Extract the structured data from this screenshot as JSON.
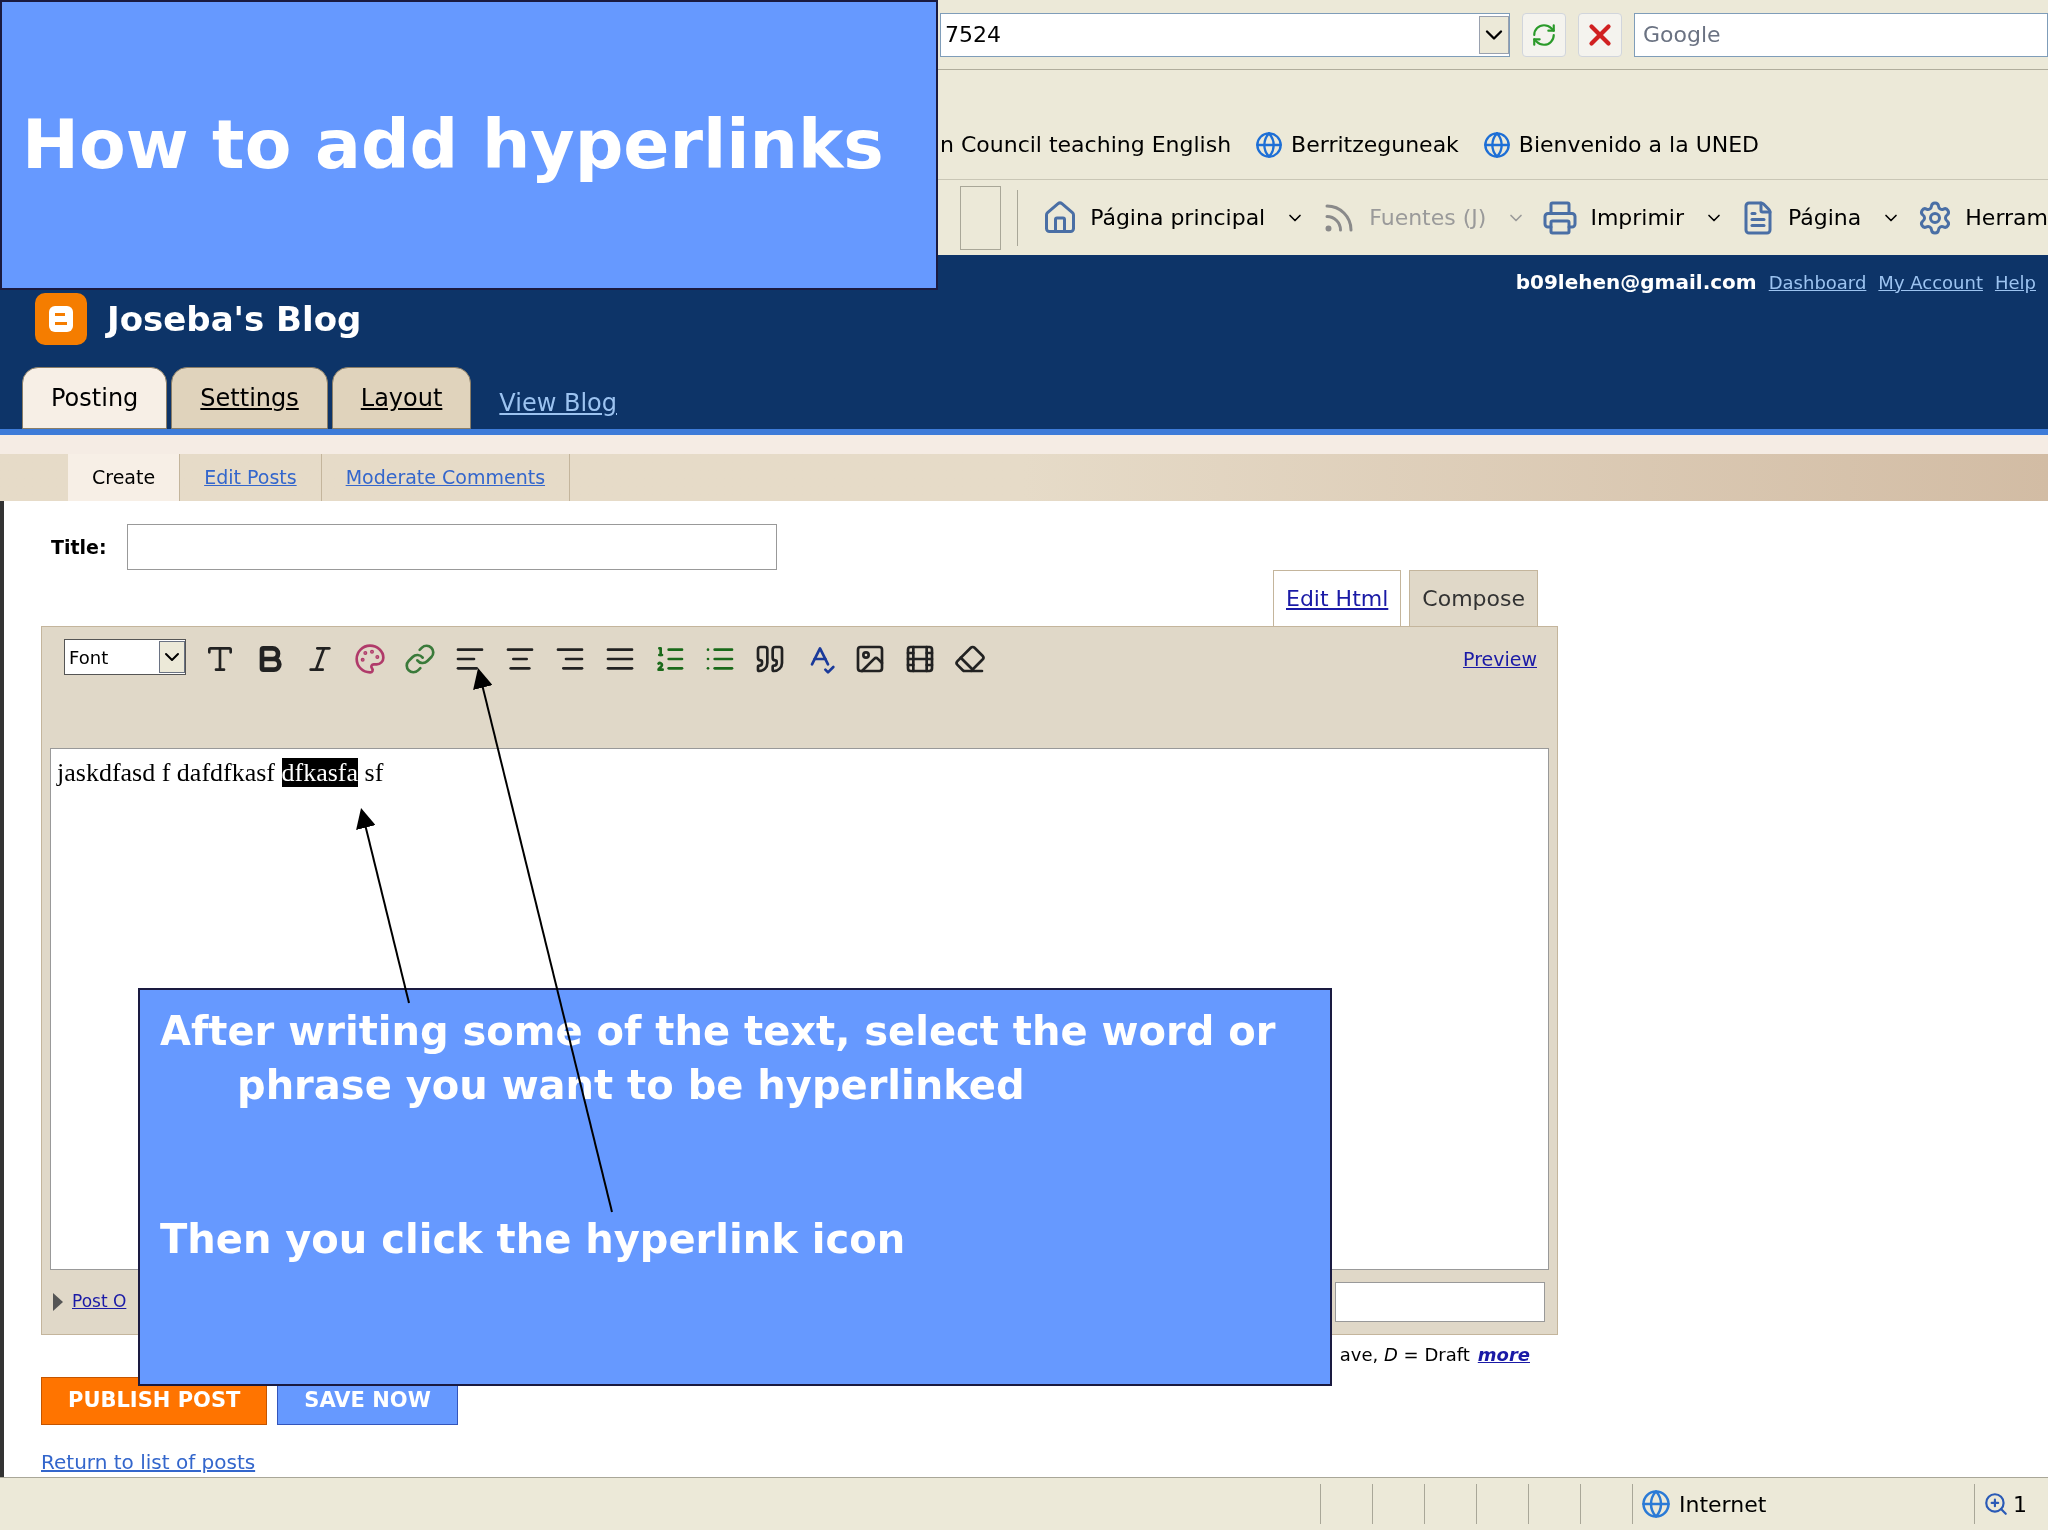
{
  "slide": {
    "title": "How to add hyperlinks",
    "callout": [
      "After writing some of the text, select the word or phrase you want to be hyperlinked",
      "Then you click the hyperlink icon"
    ]
  },
  "browser": {
    "address": "7524",
    "search_placeholder": "Google",
    "links": [
      "n Council teaching English",
      "Berritzeguneak",
      "Bienvenido a la UNED"
    ],
    "commands": [
      {
        "label": "Página principal",
        "kind": "home",
        "disabled": false
      },
      {
        "label": "Fuentes (J)",
        "kind": "feed",
        "disabled": true
      },
      {
        "label": "Imprimir",
        "kind": "print",
        "disabled": false
      },
      {
        "label": "Página",
        "kind": "page",
        "disabled": false
      },
      {
        "label": "Herram",
        "kind": "tools",
        "disabled": false
      }
    ],
    "status": "Internet",
    "zoom": "1"
  },
  "blog": {
    "title": "Joseba's Blog",
    "email": "b09lehen@gmail.com",
    "user_links": [
      "Dashboard",
      "My Account",
      "Help"
    ],
    "tabs": [
      {
        "label": "Posting",
        "selected": true
      },
      {
        "label": "Settings",
        "selected": false
      },
      {
        "label": "Layout",
        "selected": false
      }
    ],
    "view_blog": "View Blog",
    "subtabs": [
      {
        "label": "Create",
        "selected": true
      },
      {
        "label": "Edit Posts",
        "selected": false
      },
      {
        "label": "Moderate Comments",
        "selected": false
      }
    ]
  },
  "editor": {
    "title_label": "Title:",
    "modes": [
      {
        "label": "Edit Html",
        "selected": false
      },
      {
        "label": "Compose",
        "selected": true
      }
    ],
    "font": "Font",
    "preview": "Preview",
    "body": {
      "before": "jaskdfasd f dafdfkasf ",
      "selected": "dfkasfa",
      "after": " sf"
    },
    "post_options": "Post O",
    "shortcuts": "ave, *D* = Draft",
    "shortcuts_more": "more",
    "buttons": [
      {
        "label": "PUBLISH POST",
        "kind": "primary"
      },
      {
        "label": "SAVE NOW",
        "kind": "secondary"
      }
    ],
    "return_link": "Return to list of posts"
  }
}
